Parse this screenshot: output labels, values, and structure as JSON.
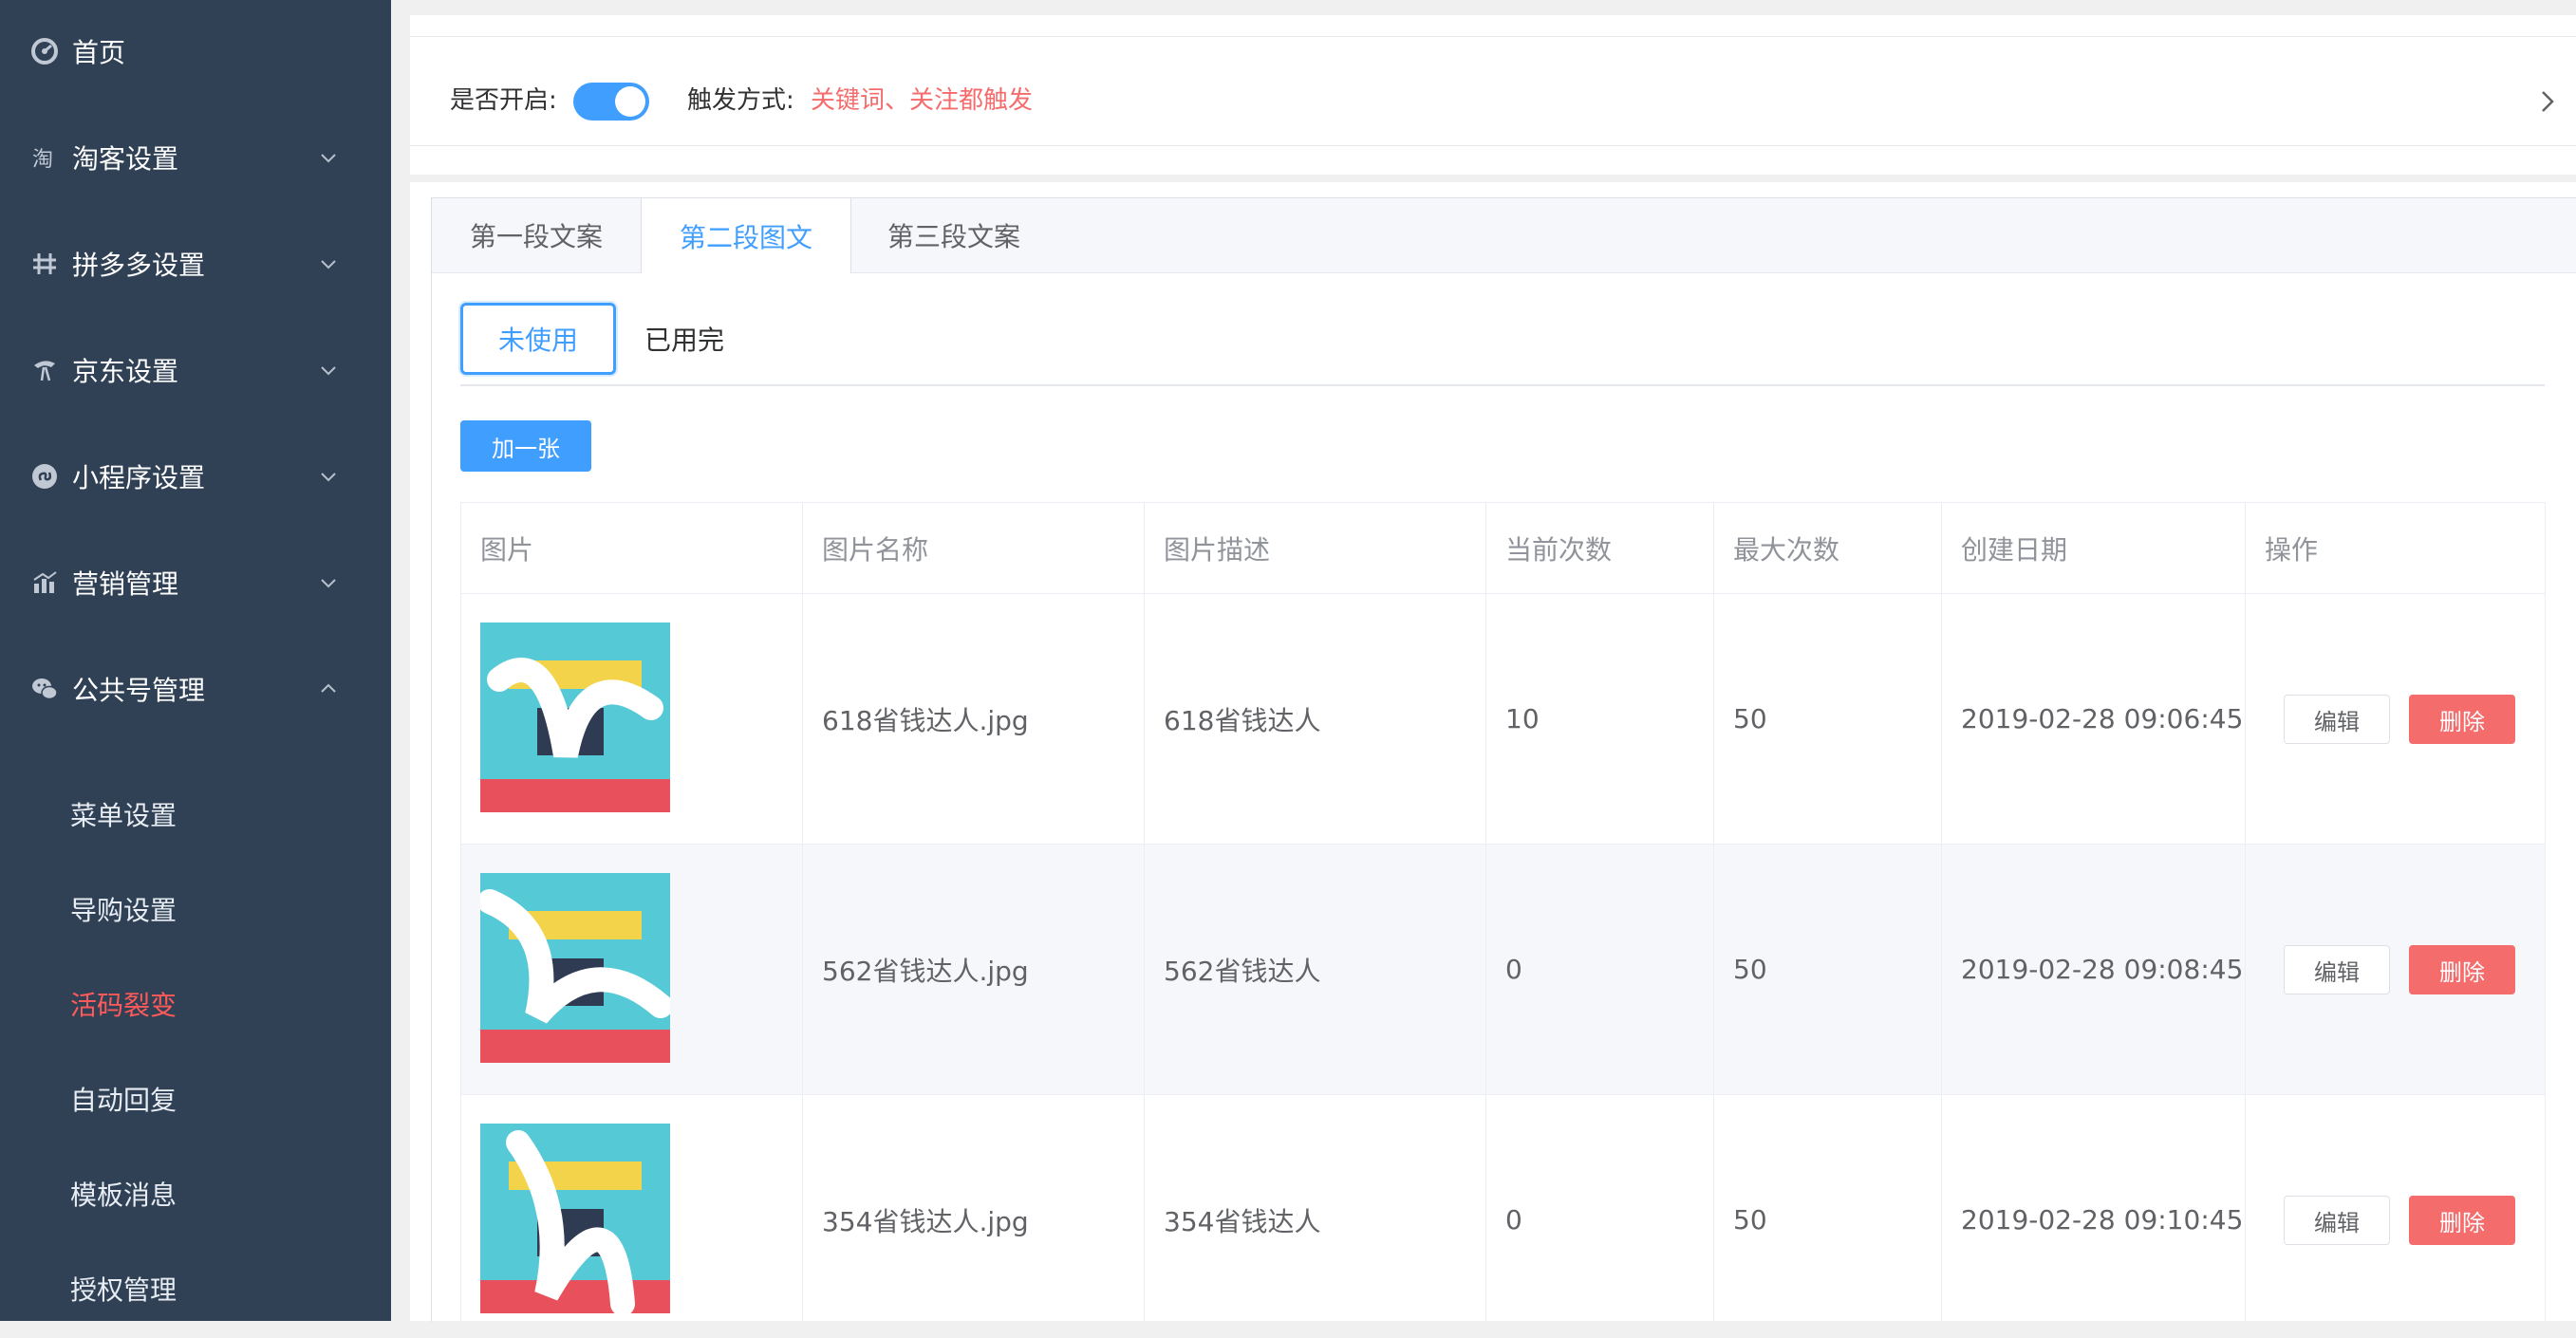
{
  "sidebar": {
    "items": [
      {
        "label": "首页",
        "icon": "dashboard-icon"
      },
      {
        "label": "淘客设置",
        "icon": "taoke-icon"
      },
      {
        "label": "拼多多设置",
        "icon": "pinduoduo-icon"
      },
      {
        "label": "京东设置",
        "icon": "jd-icon"
      },
      {
        "label": "小程序设置",
        "icon": "miniprogram-icon"
      },
      {
        "label": "营销管理",
        "icon": "chart-icon"
      },
      {
        "label": "公共号管理",
        "icon": "wechat-icon"
      }
    ],
    "subitems": [
      {
        "label": "菜单设置"
      },
      {
        "label": "导购设置"
      },
      {
        "label": "活码裂变"
      },
      {
        "label": "自动回复"
      },
      {
        "label": "模板消息"
      },
      {
        "label": "授权管理"
      }
    ]
  },
  "settings": {
    "enable_label": "是否开启:",
    "trigger_label": "触发方式:",
    "trigger_value": "关键词、关注都触发"
  },
  "tabs": [
    {
      "label": "第一段文案"
    },
    {
      "label": "第二段图文"
    },
    {
      "label": "第三段文案"
    }
  ],
  "subtabs": [
    {
      "label": "未使用"
    },
    {
      "label": "已用完"
    }
  ],
  "add_button": "加一张",
  "table": {
    "headers": [
      "图片",
      "图片名称",
      "图片描述",
      "当前次数",
      "最大次数",
      "创建日期",
      "操作"
    ],
    "rows": [
      {
        "name": "618省钱达人.jpg",
        "desc": "618省钱达人",
        "current": "10",
        "max": "50",
        "date": "2019-02-28 09:06:45"
      },
      {
        "name": "562省钱达人.jpg",
        "desc": "562省钱达人",
        "current": "0",
        "max": "50",
        "date": "2019-02-28 09:08:45"
      },
      {
        "name": "354省钱达人.jpg",
        "desc": "354省钱达人",
        "current": "0",
        "max": "50",
        "date": "2019-02-28 09:10:45"
      }
    ],
    "edit_label": "编辑",
    "delete_label": "删除"
  },
  "colors": {
    "sidebar_bg": "#304156",
    "primary": "#409eff",
    "danger": "#f56c6c",
    "active_menu": "#ff5a5a"
  }
}
